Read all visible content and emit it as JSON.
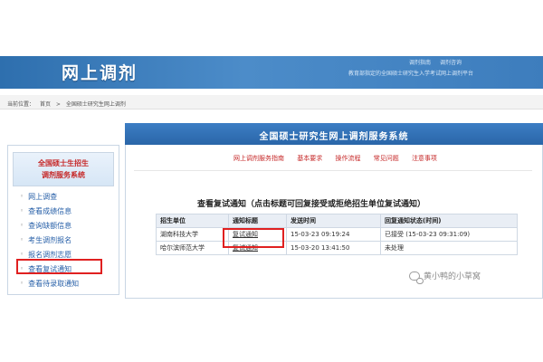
{
  "banner": {
    "title": "网上调剂",
    "links": [
      "调剂指南",
      "调剂咨询"
    ],
    "subtitle": "教育部指定的全国硕士研究生入学考试网上调剂平台"
  },
  "breadcrumb": {
    "label": "当前位置：",
    "home": "首页",
    "separator": ">",
    "current": "全国硕士研究生网上调剂"
  },
  "system_title": "全国硕士研究生网上调剂服务系统",
  "sidebar": {
    "heading_line1": "全国硕士生招生",
    "heading_line2": "调剂服务系统",
    "items": [
      {
        "label": "网上调查"
      },
      {
        "label": "查看成绩信息"
      },
      {
        "label": "查询缺额信息"
      },
      {
        "label": "考生调剂报名"
      },
      {
        "label": "报名调剂志愿"
      },
      {
        "label": "查看复试通知"
      },
      {
        "label": "查看待录取通知"
      }
    ]
  },
  "top_links": [
    "网上调剂服务指南",
    "基本要求",
    "操作流程",
    "常见问题",
    "注意事项"
  ],
  "notice": {
    "title": "查看复试通知（点击标题可回复接受或拒绝招生单位复试通知）",
    "columns": [
      "招生单位",
      "通知标题",
      "发送时间",
      "回复通知状态(时间)"
    ],
    "rows": [
      {
        "unit": "湖南科技大学",
        "notice_title": "复试通知",
        "sent_time": "15-03-23 09:19:24",
        "reply_status": "已接受 (15-03-23 09:31:09)"
      },
      {
        "unit": "哈尔滨师范大学",
        "notice_title": "复试通知",
        "sent_time": "15-03-20 13:41:50",
        "reply_status": "未处理"
      }
    ]
  },
  "watermark": {
    "text": "黄小鸭的小草窝",
    "icon": "wechat-icon"
  },
  "colors": {
    "banner_blue": "#3d7dbd",
    "highlight_red": "#e02020",
    "link_blue": "#1c4fa0",
    "heading_red": "#c62828"
  }
}
